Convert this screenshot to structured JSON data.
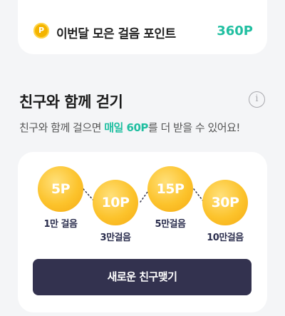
{
  "points_card": {
    "coin_symbol": "P",
    "label": "이번달 모은 걸음 포인트",
    "value": "360P"
  },
  "friends_section": {
    "title": "친구와 함께 걷기",
    "info_icon": "info-icon",
    "subtitle_before": "친구와 함께 걸으면 ",
    "subtitle_highlight": "매일 60P",
    "subtitle_after": "를 더 받을 수 있어요!",
    "accent_color": "#21bfa1",
    "rewards": [
      {
        "points": "5P",
        "steps": "1만 걸음"
      },
      {
        "points": "10P",
        "steps": "3만걸음"
      },
      {
        "points": "15P",
        "steps": "5만걸음"
      },
      {
        "points": "30P",
        "steps": "10만걸음"
      }
    ],
    "cta_label": "새로운 친구맺기"
  }
}
